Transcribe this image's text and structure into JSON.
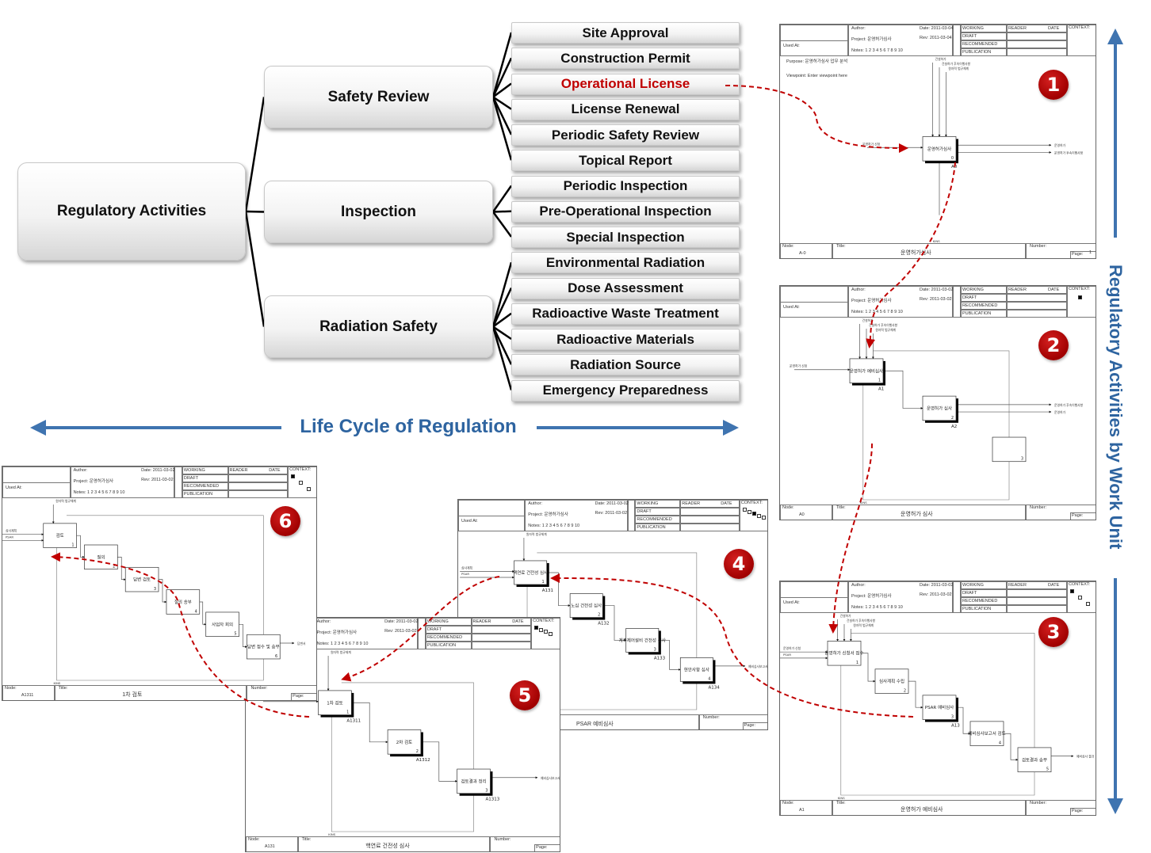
{
  "tree": {
    "root": "Regulatory Activities",
    "groups": [
      {
        "label": "Safety Review",
        "items": [
          "Site Approval",
          "Construction Permit",
          "Operational License",
          "License Renewal",
          "Periodic Safety Review",
          "Topical Report"
        ]
      },
      {
        "label": "Inspection",
        "items": [
          "Periodic Inspection",
          "Pre-Operational Inspection",
          "Special Inspection"
        ]
      },
      {
        "label": "Radiation Safety",
        "items": [
          "Environmental Radiation",
          "Dose Assessment",
          "Radioactive Waste Treatment",
          "Radioactive Materials",
          "Radiation Source",
          "Emergency Preparedness"
        ]
      }
    ],
    "highlighted_item": "Operational License"
  },
  "axes": {
    "horizontal": "Life Cycle of Regulation",
    "vertical": "Regulatory Activities by Work Unit"
  },
  "colors": {
    "accent_blue": "#3f74b0",
    "highlight_red": "#c00000",
    "badge_red": "#b00000"
  },
  "frame_labels": {
    "used_at": "Used At:",
    "author": "Author:",
    "status": [
      "WORKING",
      "DRAFT",
      "RECOMMENDED",
      "PUBLICATION"
    ],
    "reader": "READER",
    "date_col": "DATE",
    "context": "CONTEXT:",
    "node": "Node:",
    "title": "Title:",
    "number": "Number:",
    "page": "Page:"
  },
  "frames": [
    {
      "badge": "1",
      "date": "Date: 2011-03-04",
      "rev": "Rev: 2011-03-04",
      "project": "Project: 운영허가심사",
      "notes": "Notes: 1 2 3 4 5 6 7 8 9 10",
      "purpose": "Purpose:  운영허가심사 업무 분석",
      "viewpoint": "Viewpoint:   Enter viewpoint here",
      "node": "A-0",
      "title": "운영허가심사",
      "page_no": "1",
      "context": [],
      "boxes": [
        {
          "label": "운영허가심사",
          "num": "0",
          "node": "A0"
        }
      ],
      "inputs": [
        "운영허가 신청"
      ],
      "controls": [
        "건설허가",
        "건설허가 후속이행사항",
        "원자력 법규체계"
      ],
      "outputs": [
        "운영허가",
        "운영허가 후속이행사항"
      ],
      "mechanism": "KINS"
    },
    {
      "badge": "2",
      "date": "Date: 2011-03-02",
      "rev": "Rev: 2011-03-02",
      "project": "Project: 운영허가심사",
      "notes": "Notes: 1 2 3 4 5 6 7 8 9 10",
      "node": "A0",
      "title": "운영허가 심사",
      "page_no": "",
      "context": [
        "filled"
      ],
      "boxes": [
        {
          "label": "운영허가 예비심사",
          "num": "1",
          "node": "A1"
        },
        {
          "label": "운영허가 심사",
          "num": "2",
          "node": "A2"
        },
        {
          "label": "",
          "num": "3",
          "node": ""
        }
      ],
      "inputs": [
        "운영허가 신청"
      ],
      "controls": [
        "건설허가",
        "건설허가 후속이행사항",
        "원자력 법규체계"
      ],
      "outputs": [
        "운영허가 후속이행사항",
        "운영허가"
      ],
      "mechanism": "KINS"
    },
    {
      "badge": "3",
      "date": "Date: 2011-03-02",
      "rev": "Rev: 2011-03-02",
      "project": "Project: 운영허가심사",
      "notes": "Notes: 1 2 3 4 5 6 7 8 9 10",
      "node": "A1",
      "title": "운영허가 예비심사",
      "page_no": "",
      "context": [
        "filled",
        "empty",
        "empty"
      ],
      "boxes": [
        {
          "label": "운영허가 신청서 접수",
          "num": "1",
          "node": ""
        },
        {
          "label": "심사계획 수립",
          "num": "2",
          "node": ""
        },
        {
          "label": "PSAR 예비심사",
          "num": "3",
          "node": "A13"
        },
        {
          "label": "예비심사보고서 검토",
          "num": "4",
          "node": ""
        },
        {
          "label": "검토결과 송부",
          "num": "5",
          "node": ""
        }
      ],
      "inputs": [
        "운영허가 신청",
        "PSAR"
      ],
      "controls": [
        "건설허가",
        "건설허가 후속이행사항",
        "원자력 법규체계"
      ],
      "outputs": [
        "예비심사 결과"
      ],
      "mechanism": "KINS"
    },
    {
      "badge": "4",
      "date": "Date: 2011-03-02",
      "rev": "Rev: 2011-03-02",
      "project": "Project: 운영허가심사",
      "notes": "Notes: 1 2 3 4 5 6 7 8 9 10",
      "node": "A13",
      "title": "PSAR 예비심사",
      "page_no": "",
      "context": [
        "empty",
        "empty",
        "filled",
        "empty",
        "empty"
      ],
      "boxes": [
        {
          "label": "핵연료 건전성 심사",
          "num": "1",
          "node": "A131"
        },
        {
          "label": "노심 건전성 심사",
          "num": "2",
          "node": "A132"
        },
        {
          "label": "계측제어설비 건전성 심사",
          "num": "3",
          "node": "A133"
        },
        {
          "label": "현안사항 심사",
          "num": "4",
          "node": "A134"
        }
      ],
      "inputs": [
        "심사계획",
        "PSAR"
      ],
      "controls": [
        "원자력 법규체계"
      ],
      "outputs": [
        "예비심사보고서"
      ],
      "mechanism": ""
    },
    {
      "badge": "5",
      "date": "Date: 2011-03-02",
      "rev": "Rev: 2011-03-02",
      "project": "Project: 운영허가심사",
      "notes": "Notes: 1 2 3 4 5 6 7 8 9 10",
      "node": "A131",
      "title": "핵연료 건전성 심사",
      "page_no": "",
      "context": [
        "filled",
        "empty",
        "empty",
        "empty"
      ],
      "boxes": [
        {
          "label": "1차 검토",
          "num": "1",
          "node": "A1311"
        },
        {
          "label": "2차 검토",
          "num": "2",
          "node": "A1312"
        },
        {
          "label": "검토결과 정리",
          "num": "3",
          "node": "A1313"
        }
      ],
      "inputs": [
        "PSAR"
      ],
      "controls": [
        "원자력 법규체계"
      ],
      "outputs": [
        "예비심사보고서"
      ],
      "mechanism": "KINS"
    },
    {
      "badge": "6",
      "date": "Date: 2011-03-02",
      "rev": "Rev: 2011-03-02",
      "project": "Project: 운영허가심사",
      "notes": "Notes: 1 2 3 4 5 6 7 8 9 10",
      "node": "A1311",
      "title": "1차 검토",
      "page_no": "",
      "context": [
        "filled",
        "empty",
        "empty"
      ],
      "boxes": [
        {
          "label": "검토",
          "num": "1",
          "node": ""
        },
        {
          "label": "질의",
          "num": "2",
          "node": ""
        },
        {
          "label": "답변 검토",
          "num": "3",
          "node": ""
        },
        {
          "label": "질의 송부",
          "num": "4",
          "node": ""
        },
        {
          "label": "사업자 회의",
          "num": "5",
          "node": ""
        },
        {
          "label": "답변 접수 및 송부",
          "num": "6",
          "node": ""
        }
      ],
      "inputs": [
        "심사계획",
        "PSAR"
      ],
      "controls": [
        "원자력 법규체계"
      ],
      "outputs": [
        "답변서"
      ],
      "mechanism": "KINS"
    }
  ]
}
